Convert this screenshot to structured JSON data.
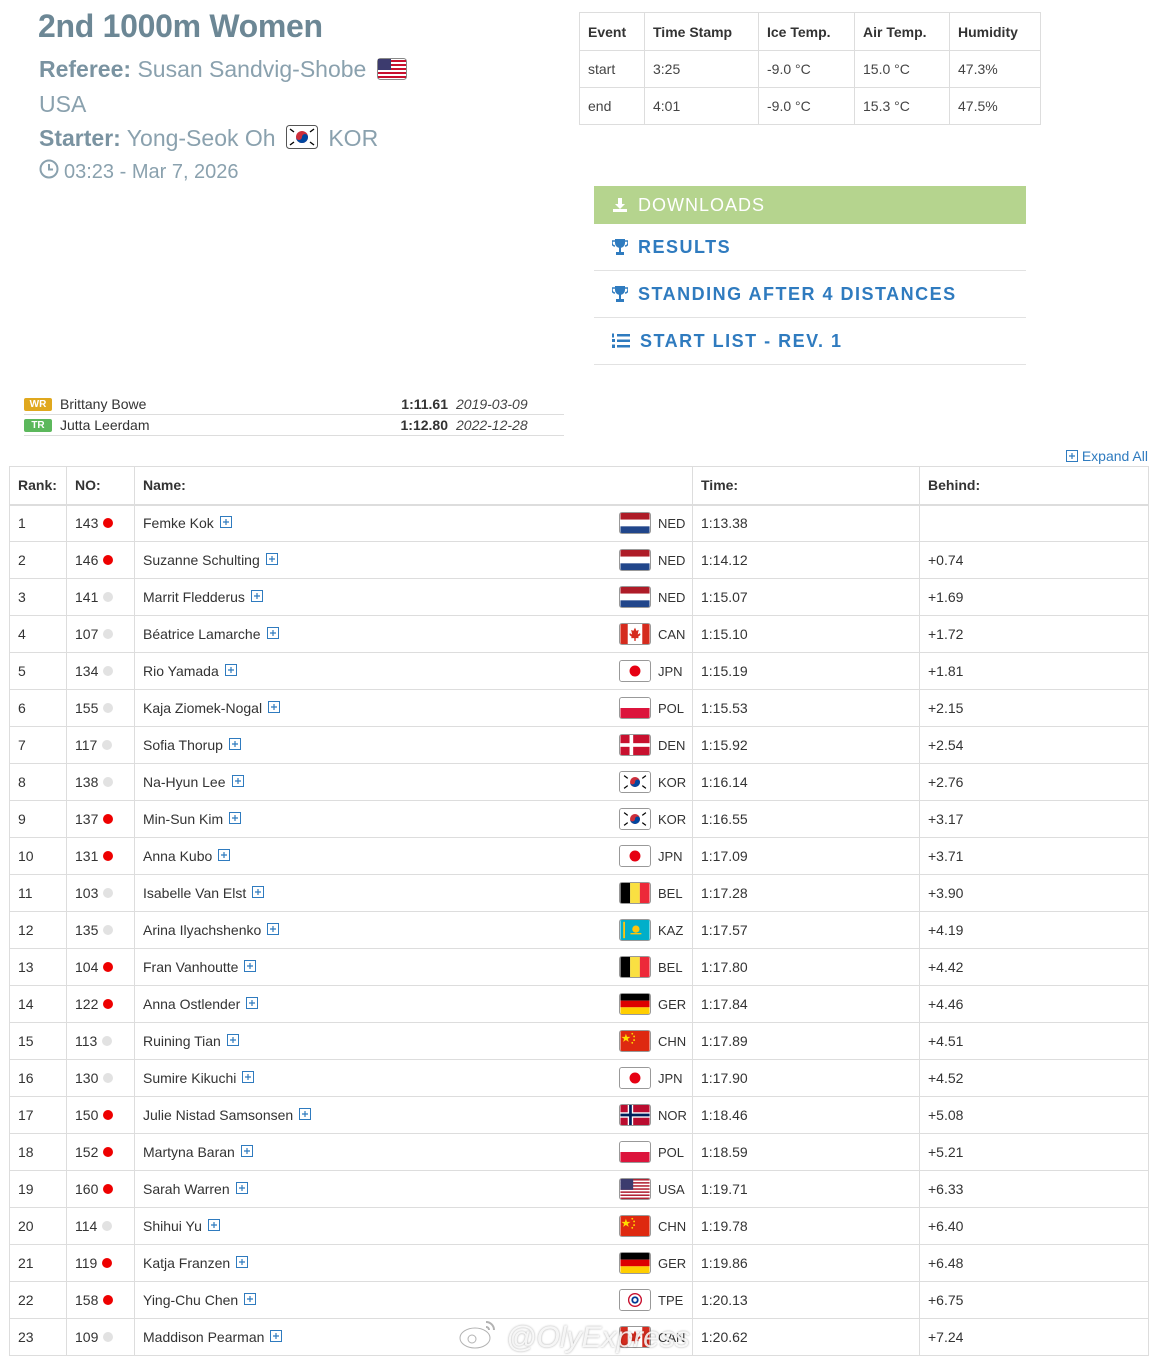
{
  "header": {
    "title": "2nd 1000m Women",
    "referee_label": "Referee:",
    "referee_name": "Susan Sandvig-Shobe",
    "referee_country": "USA",
    "starter_label": "Starter:",
    "starter_name": "Yong-Seok Oh",
    "starter_country": "KOR",
    "datetime": "03:23 - Mar 7, 2026"
  },
  "conditions": {
    "headers": [
      "Event",
      "Time Stamp",
      "Ice Temp.",
      "Air Temp.",
      "Humidity"
    ],
    "rows": [
      [
        "start",
        "3:25",
        "-9.0 °C",
        "15.0 °C",
        "47.3%"
      ],
      [
        "end",
        "4:01",
        "-9.0 °C",
        "15.3 °C",
        "47.5%"
      ]
    ]
  },
  "links": {
    "downloads": "DOWNLOADS",
    "results": "RESULTS",
    "standing": "STANDING AFTER 4 DISTANCES",
    "start_list": "START LIST - REV. 1"
  },
  "records": [
    {
      "badge": "WR",
      "name": "Brittany Bowe",
      "time": "1:11.61",
      "date": "2019-03-09",
      "color": "#e0a81e"
    },
    {
      "badge": "TR",
      "name": "Jutta Leerdam",
      "time": "1:12.80",
      "date": "2022-12-28",
      "color": "#5cb85c"
    }
  ],
  "expand_all": "Expand All",
  "table": {
    "headers": {
      "rank": "Rank:",
      "no": "NO:",
      "name": "Name:",
      "time": "Time:",
      "behind": "Behind:"
    },
    "rows": [
      {
        "rank": "1",
        "no": "143",
        "dot": "red",
        "name": "Femke Kok",
        "nat": "NED",
        "time": "1:13.38",
        "behind": ""
      },
      {
        "rank": "2",
        "no": "146",
        "dot": "red",
        "name": "Suzanne Schulting",
        "nat": "NED",
        "time": "1:14.12",
        "behind": "+0.74"
      },
      {
        "rank": "3",
        "no": "141",
        "dot": "gray",
        "name": "Marrit Fledderus",
        "nat": "NED",
        "time": "1:15.07",
        "behind": "+1.69"
      },
      {
        "rank": "4",
        "no": "107",
        "dot": "gray",
        "name": "Béatrice Lamarche",
        "nat": "CAN",
        "time": "1:15.10",
        "behind": "+1.72"
      },
      {
        "rank": "5",
        "no": "134",
        "dot": "gray",
        "name": "Rio Yamada",
        "nat": "JPN",
        "time": "1:15.19",
        "behind": "+1.81"
      },
      {
        "rank": "6",
        "no": "155",
        "dot": "gray",
        "name": "Kaja Ziomek-Nogal",
        "nat": "POL",
        "time": "1:15.53",
        "behind": "+2.15"
      },
      {
        "rank": "7",
        "no": "117",
        "dot": "gray",
        "name": "Sofia Thorup",
        "nat": "DEN",
        "time": "1:15.92",
        "behind": "+2.54"
      },
      {
        "rank": "8",
        "no": "138",
        "dot": "gray",
        "name": "Na-Hyun Lee",
        "nat": "KOR",
        "time": "1:16.14",
        "behind": "+2.76"
      },
      {
        "rank": "9",
        "no": "137",
        "dot": "red",
        "name": "Min-Sun Kim",
        "nat": "KOR",
        "time": "1:16.55",
        "behind": "+3.17"
      },
      {
        "rank": "10",
        "no": "131",
        "dot": "red",
        "name": "Anna Kubo",
        "nat": "JPN",
        "time": "1:17.09",
        "behind": "+3.71"
      },
      {
        "rank": "11",
        "no": "103",
        "dot": "gray",
        "name": "Isabelle Van Elst",
        "nat": "BEL",
        "time": "1:17.28",
        "behind": "+3.90"
      },
      {
        "rank": "12",
        "no": "135",
        "dot": "gray",
        "name": "Arina Ilyachshenko",
        "nat": "KAZ",
        "time": "1:17.57",
        "behind": "+4.19"
      },
      {
        "rank": "13",
        "no": "104",
        "dot": "red",
        "name": "Fran Vanhoutte",
        "nat": "BEL",
        "time": "1:17.80",
        "behind": "+4.42"
      },
      {
        "rank": "14",
        "no": "122",
        "dot": "red",
        "name": "Anna Ostlender",
        "nat": "GER",
        "time": "1:17.84",
        "behind": "+4.46"
      },
      {
        "rank": "15",
        "no": "113",
        "dot": "gray",
        "name": "Ruining Tian",
        "nat": "CHN",
        "time": "1:17.89",
        "behind": "+4.51"
      },
      {
        "rank": "16",
        "no": "130",
        "dot": "gray",
        "name": "Sumire Kikuchi",
        "nat": "JPN",
        "time": "1:17.90",
        "behind": "+4.52"
      },
      {
        "rank": "17",
        "no": "150",
        "dot": "red",
        "name": "Julie Nistad Samsonsen",
        "nat": "NOR",
        "time": "1:18.46",
        "behind": "+5.08"
      },
      {
        "rank": "18",
        "no": "152",
        "dot": "red",
        "name": "Martyna Baran",
        "nat": "POL",
        "time": "1:18.59",
        "behind": "+5.21"
      },
      {
        "rank": "19",
        "no": "160",
        "dot": "red",
        "name": "Sarah Warren",
        "nat": "USA",
        "time": "1:19.71",
        "behind": "+6.33"
      },
      {
        "rank": "20",
        "no": "114",
        "dot": "gray",
        "name": "Shihui Yu",
        "nat": "CHN",
        "time": "1:19.78",
        "behind": "+6.40"
      },
      {
        "rank": "21",
        "no": "119",
        "dot": "red",
        "name": "Katja Franzen",
        "nat": "GER",
        "time": "1:19.86",
        "behind": "+6.48"
      },
      {
        "rank": "22",
        "no": "158",
        "dot": "red",
        "name": "Ying-Chu Chen",
        "nat": "TPE",
        "time": "1:20.13",
        "behind": "+6.75"
      },
      {
        "rank": "23",
        "no": "109",
        "dot": "gray",
        "name": "Maddison Pearman",
        "nat": "CAN",
        "time": "1:20.62",
        "behind": "+7.24"
      }
    ]
  },
  "watermark": "@OlyExpress"
}
